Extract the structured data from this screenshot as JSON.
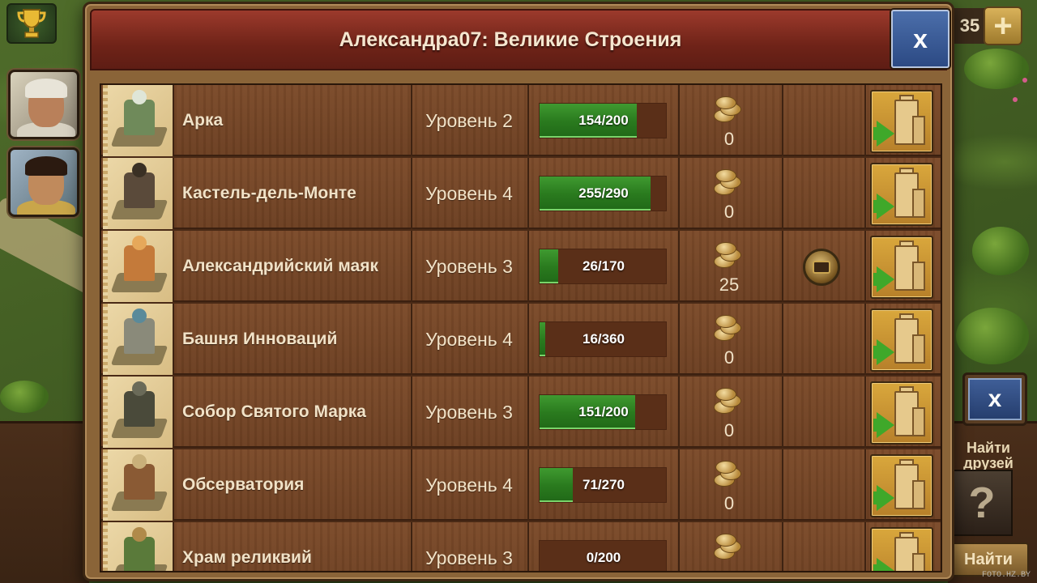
{
  "dialog": {
    "title": "Александра07: Великие Строения",
    "close_label": "x"
  },
  "colors": {
    "header_red": "#7a2a1e",
    "row_wood": "#74462a",
    "progress_green": "#2f8a22",
    "close_blue": "#3a5a96",
    "action_gold": "#c99232"
  },
  "buildings": [
    {
      "name": "Арка",
      "level": "Уровень 2",
      "progress_text": "154/200",
      "progress": 0.77,
      "fp_value": "0",
      "has_reward": false,
      "body_color": "#6f8a5a",
      "top_color": "#dfe6d8"
    },
    {
      "name": "Кастель-дель-Монте",
      "level": "Уровень 4",
      "progress_text": "255/290",
      "progress": 0.88,
      "fp_value": "0",
      "has_reward": false,
      "body_color": "#5a4a3a",
      "top_color": "#3a3024"
    },
    {
      "name": "Александрийский маяк",
      "level": "Уровень 3",
      "progress_text": "26/170",
      "progress": 0.15,
      "fp_value": "25",
      "has_reward": true,
      "body_color": "#c47a3a",
      "top_color": "#e6a85a"
    },
    {
      "name": "Башня Инноваций",
      "level": "Уровень 4",
      "progress_text": "16/360",
      "progress": 0.044,
      "fp_value": "0",
      "has_reward": false,
      "body_color": "#8a8a7a",
      "top_color": "#5a8a9a"
    },
    {
      "name": "Собор Святого Марка",
      "level": "Уровень 3",
      "progress_text": "151/200",
      "progress": 0.755,
      "fp_value": "0",
      "has_reward": false,
      "body_color": "#4a4a3a",
      "top_color": "#6a6a58"
    },
    {
      "name": "Обсерватория",
      "level": "Уровень 4",
      "progress_text": "71/270",
      "progress": 0.263,
      "fp_value": "0",
      "has_reward": false,
      "body_color": "#8a5a34",
      "top_color": "#c9b07a"
    },
    {
      "name": "Храм реликвий",
      "level": "Уровень 3",
      "progress_text": "0/200",
      "progress": 0,
      "fp_value": "",
      "has_reward": false,
      "body_color": "#5a7a3a",
      "top_color": "#b08a4a"
    }
  ],
  "background": {
    "counter": "35",
    "plus_label": "+",
    "side_close_label": "x",
    "find_friends_label": "Найти друзей",
    "unknown_portrait_label": "?",
    "find_button_label": "Найти",
    "watermark": "FOTO.HZ.BY"
  },
  "icons": {
    "trophy": "trophy-icon",
    "forge_points": "forge-points-icon",
    "reward": "reward-chest-icon",
    "contribute": "contribute-tower-icon"
  }
}
